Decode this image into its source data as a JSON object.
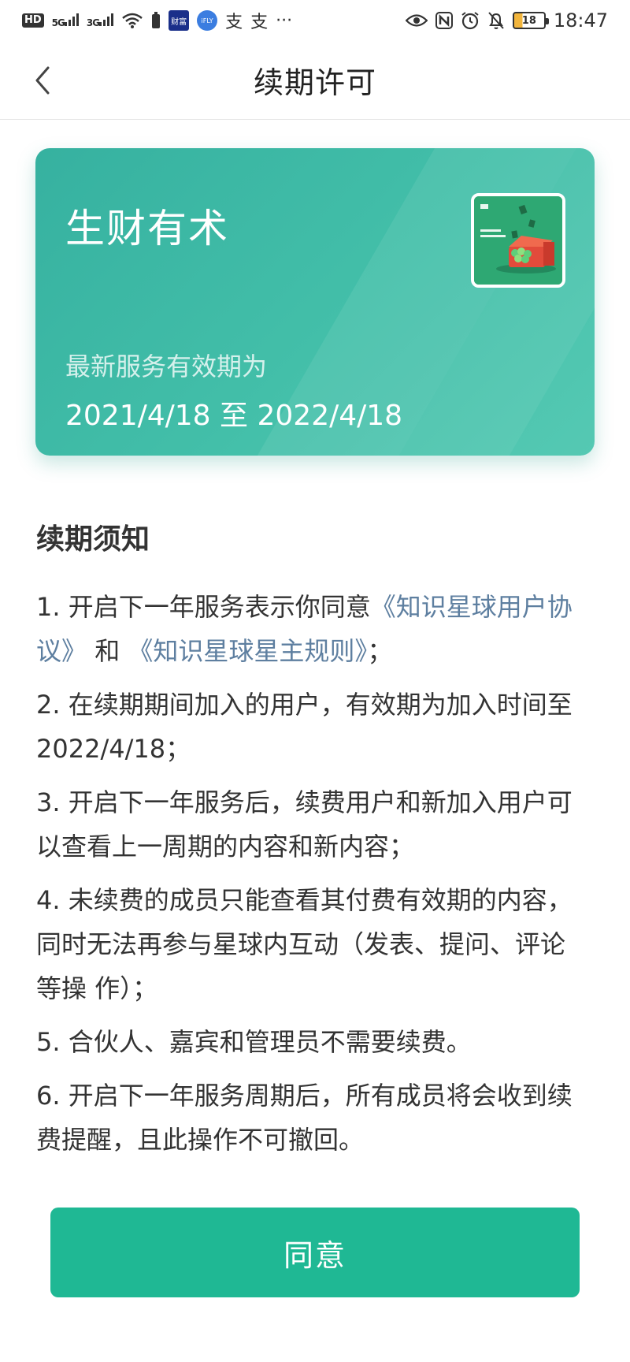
{
  "status_bar": {
    "hd_badge": "HD",
    "signal1": "5G",
    "signal2": "3G",
    "app1": "财富",
    "app2": "iFLY",
    "app3": "支",
    "app4": "支",
    "more": "···",
    "battery": "18",
    "time": "18:47"
  },
  "nav": {
    "title": "续期许可"
  },
  "card": {
    "title": "生财有术",
    "validity_label": "最新服务有效期为",
    "validity_range": "2021/4/18 至 2022/4/18"
  },
  "notice": {
    "heading": "续期须知",
    "item1_prefix": "1. 开启下一年服务表示你同意",
    "item1_link1": "《知识星球用户协议》",
    "item1_mid": "和",
    "item1_link2": "《知识星球星主规则》",
    "item1_suffix": "；",
    "item2": "2. 在续期期间加入的用户，有效期为加入时间至2022/4/18；",
    "item3": "3. 开启下一年服务后，续费用户和新加入用户可以查看上一周期的内容和新内容；",
    "item4": "4. 未续费的成员只能查看其付费有效期的内容，同时无法再参与星球内互动（发表、提问、评论等操 作）；",
    "item5": "5. 合伙人、嘉宾和管理员不需要续费。",
    "item6": "6. 开启下一年服务周期后，所有成员将会收到续费提醒，且此操作不可撤回。"
  },
  "actions": {
    "agree_label": "同意"
  },
  "colors": {
    "brand_green": "#1fb894",
    "card_green": "#43bfa9",
    "link_blue": "#5e7fa0"
  }
}
